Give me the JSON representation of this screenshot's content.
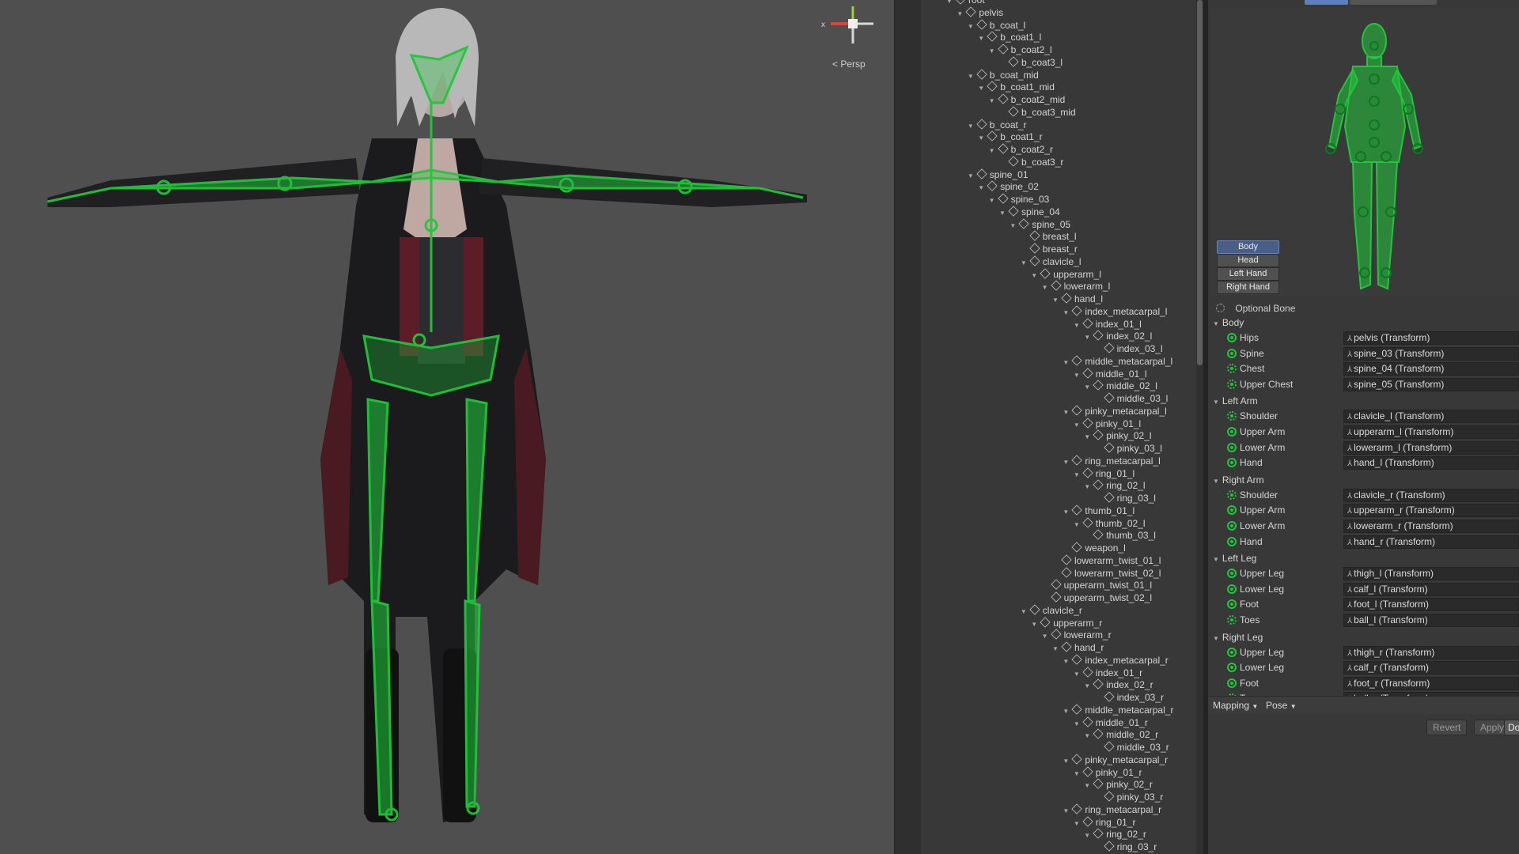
{
  "viewport": {
    "projection_label": "Persp",
    "gizmo_axis_label": "x"
  },
  "hierarchy": {
    "rows": [
      {
        "label": "root",
        "depth": 0,
        "expanded": true
      },
      {
        "label": "pelvis",
        "depth": 1,
        "expanded": true
      },
      {
        "label": "b_coat_l",
        "depth": 2,
        "expanded": true
      },
      {
        "label": "b_coat1_l",
        "depth": 3,
        "expanded": true
      },
      {
        "label": "b_coat2_l",
        "depth": 4,
        "expanded": true
      },
      {
        "label": "b_coat3_l",
        "depth": 5,
        "expanded": false
      },
      {
        "label": "b_coat_mid",
        "depth": 2,
        "expanded": true
      },
      {
        "label": "b_coat1_mid",
        "depth": 3,
        "expanded": true
      },
      {
        "label": "b_coat2_mid",
        "depth": 4,
        "expanded": true
      },
      {
        "label": "b_coat3_mid",
        "depth": 5,
        "expanded": false
      },
      {
        "label": "b_coat_r",
        "depth": 2,
        "expanded": true
      },
      {
        "label": "b_coat1_r",
        "depth": 3,
        "expanded": true
      },
      {
        "label": "b_coat2_r",
        "depth": 4,
        "expanded": true
      },
      {
        "label": "b_coat3_r",
        "depth": 5,
        "expanded": false
      },
      {
        "label": "spine_01",
        "depth": 2,
        "expanded": true
      },
      {
        "label": "spine_02",
        "depth": 3,
        "expanded": true
      },
      {
        "label": "spine_03",
        "depth": 4,
        "expanded": true
      },
      {
        "label": "spine_04",
        "depth": 5,
        "expanded": true
      },
      {
        "label": "spine_05",
        "depth": 6,
        "expanded": true
      },
      {
        "label": "breast_l",
        "depth": 7,
        "expanded": false
      },
      {
        "label": "breast_r",
        "depth": 7,
        "expanded": false
      },
      {
        "label": "clavicle_l",
        "depth": 7,
        "expanded": true
      },
      {
        "label": "upperarm_l",
        "depth": 8,
        "expanded": true
      },
      {
        "label": "lowerarm_l",
        "depth": 9,
        "expanded": true
      },
      {
        "label": "hand_l",
        "depth": 10,
        "expanded": true
      },
      {
        "label": "index_metacarpal_l",
        "depth": 11,
        "expanded": true
      },
      {
        "label": "index_01_l",
        "depth": 12,
        "expanded": true
      },
      {
        "label": "index_02_l",
        "depth": 13,
        "expanded": true
      },
      {
        "label": "index_03_l",
        "depth": 14,
        "expanded": false
      },
      {
        "label": "middle_metacarpal_l",
        "depth": 11,
        "expanded": true
      },
      {
        "label": "middle_01_l",
        "depth": 12,
        "expanded": true
      },
      {
        "label": "middle_02_l",
        "depth": 13,
        "expanded": true
      },
      {
        "label": "middle_03_l",
        "depth": 14,
        "expanded": false
      },
      {
        "label": "pinky_metacarpal_l",
        "depth": 11,
        "expanded": true
      },
      {
        "label": "pinky_01_l",
        "depth": 12,
        "expanded": true
      },
      {
        "label": "pinky_02_l",
        "depth": 13,
        "expanded": true
      },
      {
        "label": "pinky_03_l",
        "depth": 14,
        "expanded": false
      },
      {
        "label": "ring_metacarpal_l",
        "depth": 11,
        "expanded": true
      },
      {
        "label": "ring_01_l",
        "depth": 12,
        "expanded": true
      },
      {
        "label": "ring_02_l",
        "depth": 13,
        "expanded": true
      },
      {
        "label": "ring_03_l",
        "depth": 14,
        "expanded": false
      },
      {
        "label": "thumb_01_l",
        "depth": 11,
        "expanded": true
      },
      {
        "label": "thumb_02_l",
        "depth": 12,
        "expanded": true
      },
      {
        "label": "thumb_03_l",
        "depth": 13,
        "expanded": false
      },
      {
        "label": "weapon_l",
        "depth": 11,
        "expanded": false
      },
      {
        "label": "lowerarm_twist_01_l",
        "depth": 10,
        "expanded": false
      },
      {
        "label": "lowerarm_twist_02_l",
        "depth": 10,
        "expanded": false
      },
      {
        "label": "upperarm_twist_01_l",
        "depth": 9,
        "expanded": false
      },
      {
        "label": "upperarm_twist_02_l",
        "depth": 9,
        "expanded": false
      },
      {
        "label": "clavicle_r",
        "depth": 7,
        "expanded": true
      },
      {
        "label": "upperarm_r",
        "depth": 8,
        "expanded": true
      },
      {
        "label": "lowerarm_r",
        "depth": 9,
        "expanded": true
      },
      {
        "label": "hand_r",
        "depth": 10,
        "expanded": true
      },
      {
        "label": "index_metacarpal_r",
        "depth": 11,
        "expanded": true
      },
      {
        "label": "index_01_r",
        "depth": 12,
        "expanded": true
      },
      {
        "label": "index_02_r",
        "depth": 13,
        "expanded": true
      },
      {
        "label": "index_03_r",
        "depth": 14,
        "expanded": false
      },
      {
        "label": "middle_metacarpal_r",
        "depth": 11,
        "expanded": true
      },
      {
        "label": "middle_01_r",
        "depth": 12,
        "expanded": true
      },
      {
        "label": "middle_02_r",
        "depth": 13,
        "expanded": true
      },
      {
        "label": "middle_03_r",
        "depth": 14,
        "expanded": false
      },
      {
        "label": "pinky_metacarpal_r",
        "depth": 11,
        "expanded": true
      },
      {
        "label": "pinky_01_r",
        "depth": 12,
        "expanded": true
      },
      {
        "label": "pinky_02_r",
        "depth": 13,
        "expanded": true
      },
      {
        "label": "pinky_03_r",
        "depth": 14,
        "expanded": false
      },
      {
        "label": "ring_metacarpal_r",
        "depth": 11,
        "expanded": true
      },
      {
        "label": "ring_01_r",
        "depth": 12,
        "expanded": true
      },
      {
        "label": "ring_02_r",
        "depth": 13,
        "expanded": true
      },
      {
        "label": "ring_03_r",
        "depth": 14,
        "expanded": false
      }
    ]
  },
  "avatar": {
    "parts": [
      "Body",
      "Head",
      "Left Hand",
      "Right Hand"
    ],
    "optional_bone_label": "Optional Bone",
    "sections": [
      {
        "title": "Body",
        "bones": [
          {
            "name": "Hips",
            "value": "pelvis (Transform)",
            "optional": false
          },
          {
            "name": "Spine",
            "value": "spine_03 (Transform)",
            "optional": false
          },
          {
            "name": "Chest",
            "value": "spine_04 (Transform)",
            "optional": true
          },
          {
            "name": "Upper Chest",
            "value": "spine_05 (Transform)",
            "optional": true
          }
        ]
      },
      {
        "title": "Left Arm",
        "bones": [
          {
            "name": "Shoulder",
            "value": "clavicle_l (Transform)",
            "optional": true
          },
          {
            "name": "Upper Arm",
            "value": "upperarm_l (Transform)",
            "optional": false
          },
          {
            "name": "Lower Arm",
            "value": "lowerarm_l (Transform)",
            "optional": false
          },
          {
            "name": "Hand",
            "value": "hand_l (Transform)",
            "optional": false
          }
        ]
      },
      {
        "title": "Right Arm",
        "bones": [
          {
            "name": "Shoulder",
            "value": "clavicle_r (Transform)",
            "optional": true
          },
          {
            "name": "Upper Arm",
            "value": "upperarm_r (Transform)",
            "optional": false
          },
          {
            "name": "Lower Arm",
            "value": "lowerarm_r (Transform)",
            "optional": false
          },
          {
            "name": "Hand",
            "value": "hand_r (Transform)",
            "optional": false
          }
        ]
      },
      {
        "title": "Left Leg",
        "bones": [
          {
            "name": "Upper Leg",
            "value": "thigh_l (Transform)",
            "optional": false
          },
          {
            "name": "Lower Leg",
            "value": "calf_l (Transform)",
            "optional": false
          },
          {
            "name": "Foot",
            "value": "foot_l (Transform)",
            "optional": false
          },
          {
            "name": "Toes",
            "value": "ball_l (Transform)",
            "optional": true
          }
        ]
      },
      {
        "title": "Right Leg",
        "bones": [
          {
            "name": "Upper Leg",
            "value": "thigh_r (Transform)",
            "optional": false
          },
          {
            "name": "Lower Leg",
            "value": "calf_r (Transform)",
            "optional": false
          },
          {
            "name": "Foot",
            "value": "foot_r (Transform)",
            "optional": false
          },
          {
            "name": "Toes",
            "value": "ball_r (Transform)",
            "optional": true
          }
        ]
      }
    ],
    "mapping_label": "Mapping",
    "pose_label": "Pose",
    "revert_label": "Revert",
    "apply_label": "Apply",
    "done_label": "Do"
  },
  "colors": {
    "bone_green": "#20c73a",
    "viewport_bg": "#4f4f4f",
    "panel_bg": "#383838",
    "active_button": "#4a5f86"
  }
}
